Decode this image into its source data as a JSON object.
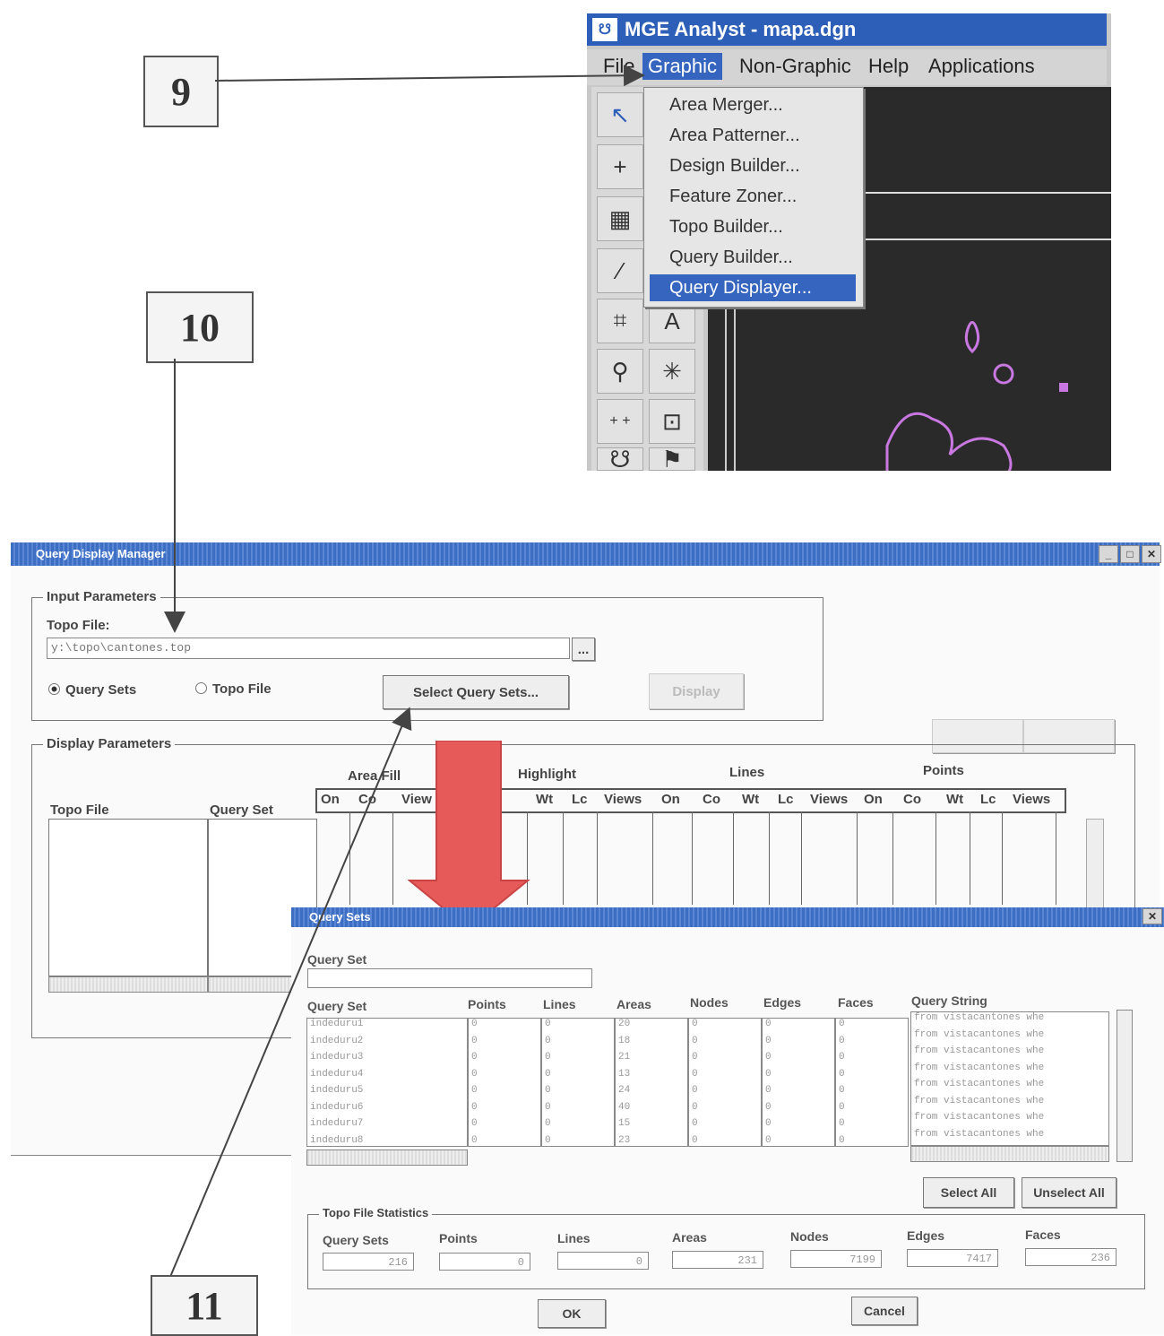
{
  "callouts": {
    "c9": "9",
    "c10": "10",
    "c11": "11"
  },
  "mge": {
    "title": "MGE Analyst - mapa.dgn",
    "menu": [
      "File",
      "Graphic",
      "Non-Graphic",
      "Help",
      "Applications"
    ],
    "dropdown": [
      "Area Merger...",
      "Area Patterner...",
      "Design Builder...",
      "Feature Zoner...",
      "Topo Builder...",
      "Query Builder...",
      "Query Displayer..."
    ],
    "tool_glyphs": [
      "↖",
      "+",
      "▦",
      "⁄",
      "⌗",
      "A",
      "⚲",
      "✳",
      "+ +",
      "⊡",
      "☋",
      "⚑"
    ]
  },
  "qdm": {
    "title": "Query Display Manager",
    "input_group": "Input Parameters",
    "topo_file_label": "Topo File:",
    "topo_file_value": "y:\\topo\\cantones.top",
    "browse": "...",
    "radio_query_sets": "Query Sets",
    "radio_topo_file": "Topo File",
    "select_query_sets": "Select Query Sets...",
    "display_btn": "Display",
    "display_group": "Display Parameters",
    "col_topo_file": "Topo File",
    "col_query_set": "Query Set",
    "grp_area_fill": "Area Fill",
    "grp_highlight": "Highlight",
    "grp_lines": "Lines",
    "grp_points": "Points",
    "sub_area_fill": [
      "On",
      "Co",
      "View"
    ],
    "sub_highlight": [
      "Wt",
      "Lc",
      "Views"
    ],
    "sub_lines": [
      "On",
      "Co",
      "Wt",
      "Lc",
      "Views"
    ],
    "sub_points": [
      "On",
      "Co",
      "Wt",
      "Lc",
      "Views"
    ]
  },
  "qs": {
    "title": "Query Sets",
    "query_set_label": "Query Set",
    "columns": [
      "Query Set",
      "Points",
      "Lines",
      "Areas",
      "Nodes",
      "Edges",
      "Faces",
      "Query String"
    ],
    "rows": [
      [
        "indeduru1",
        "0",
        "0",
        "20",
        "0",
        "0",
        "0",
        "from vistacantones whe"
      ],
      [
        "indeduru2",
        "0",
        "0",
        "18",
        "0",
        "0",
        "0",
        "from vistacantones whe"
      ],
      [
        "indeduru3",
        "0",
        "0",
        "21",
        "0",
        "0",
        "0",
        "from vistacantones whe"
      ],
      [
        "indeduru4",
        "0",
        "0",
        "13",
        "0",
        "0",
        "0",
        "from vistacantones whe"
      ],
      [
        "indeduru5",
        "0",
        "0",
        "24",
        "0",
        "0",
        "0",
        "from vistacantones whe"
      ],
      [
        "indeduru6",
        "0",
        "0",
        "40",
        "0",
        "0",
        "0",
        "from vistacantones whe"
      ],
      [
        "indeduru7",
        "0",
        "0",
        "15",
        "0",
        "0",
        "0",
        "from vistacantones whe"
      ],
      [
        "indeduru8",
        "0",
        "0",
        "23",
        "0",
        "0",
        "0",
        "from vistacantones whe"
      ]
    ],
    "select_all": "Select All",
    "unselect_all": "Unselect All",
    "stats_group": "Topo File Statistics",
    "stats": [
      {
        "label": "Query Sets",
        "value": "216"
      },
      {
        "label": "Points",
        "value": "0"
      },
      {
        "label": "Lines",
        "value": "0"
      },
      {
        "label": "Areas",
        "value": "231"
      },
      {
        "label": "Nodes",
        "value": "7199"
      },
      {
        "label": "Edges",
        "value": "7417"
      },
      {
        "label": "Faces",
        "value": "236"
      }
    ],
    "ok": "OK",
    "cancel": "Cancel"
  },
  "colors": {
    "titlebar": "#3c6ec4",
    "menu_selection": "#3565bf",
    "arrow_fill": "#e65a5a",
    "canvas_bg": "#2a2a2a",
    "vector_color": "#c878e0"
  }
}
